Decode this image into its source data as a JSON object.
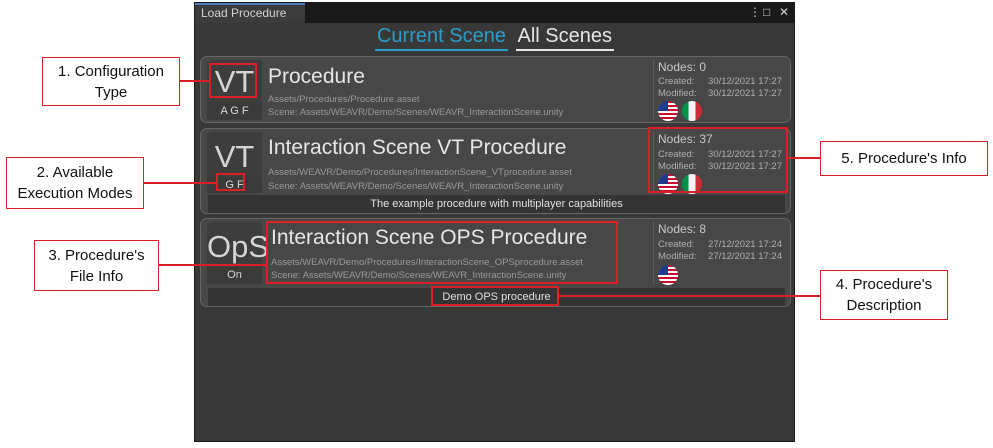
{
  "window": {
    "title": "Load Procedure",
    "menu_icon": "more-vertical-icon",
    "maximize_icon": "maximize-icon",
    "close_icon": "close-icon",
    "glyphs": {
      "menu": "⋮",
      "maximize": "□",
      "close": "✕"
    }
  },
  "scene_tabs": {
    "current": "Current Scene",
    "all": "All Scenes"
  },
  "procedures": [
    {
      "abbr": "VT",
      "modes": "A G F",
      "title": "Procedure",
      "path": "Assets/Procedures/Procedure.asset",
      "scene": "Scene: Assets/WEAVR/Demo/Scenes/WEAVR_InteractionScene.unity",
      "nodes": "Nodes: 0",
      "created_label": "Created:",
      "created": "30/12/2021 17:27",
      "modified_label": "Modified:",
      "modified": "30/12/2021 17:27",
      "languages": [
        "en-US",
        "it"
      ],
      "description": ""
    },
    {
      "abbr": "VT",
      "modes": "G F",
      "title": "Interaction Scene VT Procedure",
      "path": "Assets/WEAVR/Demo/Procedures/InteractionScene_VTprocedure.asset",
      "scene": "Scene: Assets/WEAVR/Demo/Scenes/WEAVR_InteractionScene.unity",
      "nodes": "Nodes: 37",
      "created_label": "Created:",
      "created": "30/12/2021 17:27",
      "modified_label": "Modified:",
      "modified": "30/12/2021 17:27",
      "languages": [
        "en-US",
        "it"
      ],
      "description": "The example procedure with multiplayer capabilities"
    },
    {
      "abbr": "OpS",
      "modes": "On",
      "title": "Interaction Scene OPS Procedure",
      "path": "Assets/WEAVR/Demo/Procedures/InteractionScene_OPSprocedure.asset",
      "scene": "Scene: Assets/WEAVR/Demo/Scenes/WEAVR_InteractionScene.unity",
      "nodes": "Nodes: 8",
      "created_label": "Created:",
      "created": "27/12/2021 17:24",
      "modified_label": "Modified:",
      "modified": "27/12/2021 17:24",
      "languages": [
        "en-US"
      ],
      "description": "Demo OPS procedure"
    }
  ],
  "annotations": {
    "config_type": "1. Configuration Type",
    "exec_modes": "2. Available Execution Modes",
    "file_info": "3. Procedure's File Info",
    "description": "4. Procedure's Description",
    "info": "5. Procedure's Info"
  },
  "colors": {
    "highlight": "#d92027",
    "active_tab": "#2b9ec7",
    "panel": "#383838",
    "card": "#474747"
  }
}
